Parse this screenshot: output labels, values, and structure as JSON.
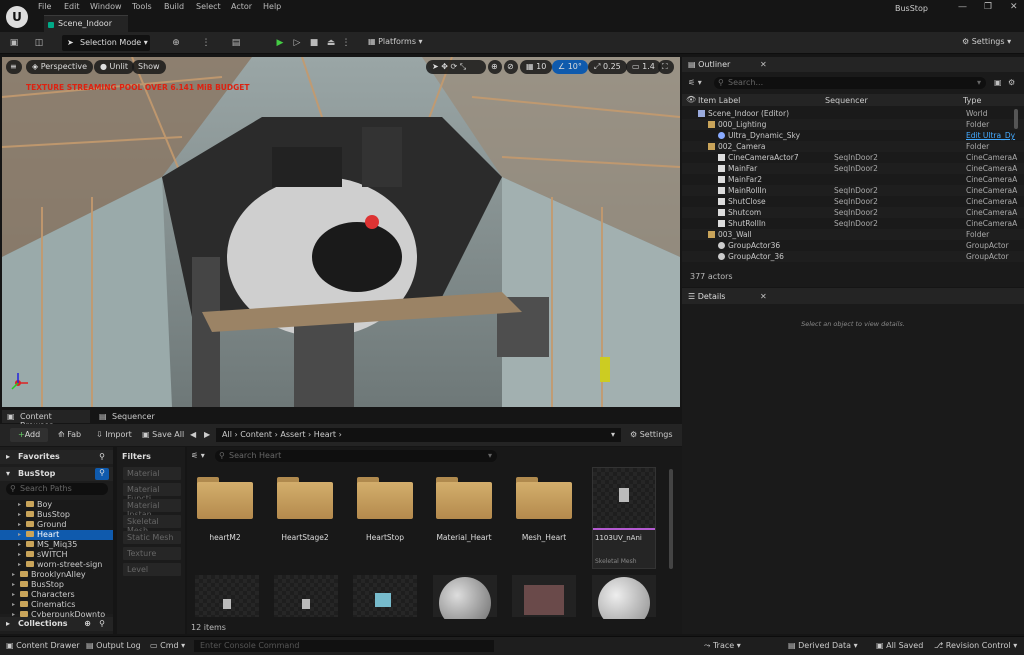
{
  "app": {
    "name": "BusStop",
    "menu": [
      "File",
      "Edit",
      "Window",
      "Tools",
      "Build",
      "Select",
      "Actor",
      "Help"
    ],
    "document_tab": "Scene_Indoor"
  },
  "toolbar": {
    "selection_mode": "Selection Mode",
    "platforms": "Platforms",
    "settings": "Settings"
  },
  "viewport": {
    "view_mode": "Perspective",
    "lighting": "Unlit",
    "show": "Show",
    "grid_size": "10",
    "rotation_snap": "10°",
    "scale_snap": "0.25",
    "camera_speed": "1.4",
    "warning": "TEXTURE STREAMING POOL OVER 6.141 MiB BUDGET"
  },
  "content_browser": {
    "tabs": [
      "Content Browser",
      "Sequencer"
    ],
    "add": "Add",
    "fab": "Fab",
    "import": "Import",
    "save_all": "Save All",
    "settings": "Settings",
    "breadcrumb": [
      "All",
      "Content",
      "Assert",
      "Heart"
    ],
    "favorites": "Favorites",
    "project": "BusStop",
    "search_paths_placeholder": "Search Paths",
    "search_assets_placeholder": "Search Heart",
    "filters_title": "Filters",
    "filters": [
      "Material",
      "Material Functi",
      "Material Instan",
      "Skeletal Mesh",
      "Static Mesh",
      "Texture",
      "Level"
    ],
    "tree": [
      {
        "label": "Boy",
        "indent": 1
      },
      {
        "label": "BusStop",
        "indent": 1
      },
      {
        "label": "Ground",
        "indent": 1
      },
      {
        "label": "Heart",
        "indent": 1,
        "selected": true
      },
      {
        "label": "MS_Miq35",
        "indent": 1
      },
      {
        "label": "sWITCH",
        "indent": 1
      },
      {
        "label": "worn-street-sign",
        "indent": 1
      },
      {
        "label": "BrooklynAlley",
        "indent": 0
      },
      {
        "label": "BusStop",
        "indent": 0
      },
      {
        "label": "Characters",
        "indent": 0
      },
      {
        "label": "Cinematics",
        "indent": 0
      },
      {
        "label": "CyberpunkDownto",
        "indent": 0
      },
      {
        "label": "CyberPunkMegapa",
        "indent": 0
      }
    ],
    "collections": "Collections",
    "folders": [
      "heartM2",
      "HeartStage2",
      "HeartStop",
      "Material_Heart",
      "Mesh_Heart"
    ],
    "featured_asset": {
      "name": "1103UV_nAni",
      "type": "Skeletal Mesh"
    },
    "item_count": "12 items"
  },
  "outliner": {
    "title": "Outliner",
    "search_placeholder": "Search...",
    "columns": [
      "Item Label",
      "Sequencer",
      "Type"
    ],
    "rows": [
      {
        "label": "Scene_Indoor (Editor)",
        "seq": "",
        "type": "World",
        "indent": 0,
        "kind": "world"
      },
      {
        "label": "000_Lighting",
        "seq": "",
        "type": "Folder",
        "indent": 1,
        "kind": "folder"
      },
      {
        "label": "Ultra_Dynamic_Sky",
        "seq": "",
        "type": "Edit Ultra_Dy",
        "indent": 2,
        "kind": "actor",
        "link": true
      },
      {
        "label": "002_Camera",
        "seq": "",
        "type": "Folder",
        "indent": 1,
        "kind": "folder"
      },
      {
        "label": "CineCameraActor7",
        "seq": "SeqInDoor2",
        "type": "CineCameraA",
        "indent": 2,
        "kind": "cam"
      },
      {
        "label": "MainFar",
        "seq": "SeqInDoor2",
        "type": "CineCameraA",
        "indent": 2,
        "kind": "cam"
      },
      {
        "label": "MainFar2",
        "seq": "",
        "type": "CineCameraA",
        "indent": 2,
        "kind": "cam"
      },
      {
        "label": "MainRollIn",
        "seq": "SeqInDoor2",
        "type": "CineCameraA",
        "indent": 2,
        "kind": "cam"
      },
      {
        "label": "ShutClose",
        "seq": "SeqInDoor2",
        "type": "CineCameraA",
        "indent": 2,
        "kind": "cam"
      },
      {
        "label": "Shutcom",
        "seq": "SeqInDoor2",
        "type": "CineCameraA",
        "indent": 2,
        "kind": "cam"
      },
      {
        "label": "ShutRollIn",
        "seq": "SeqInDoor2",
        "type": "CineCameraA",
        "indent": 2,
        "kind": "cam"
      },
      {
        "label": "003_Wall",
        "seq": "",
        "type": "Folder",
        "indent": 1,
        "kind": "folder"
      },
      {
        "label": "GroupActor36",
        "seq": "",
        "type": "GroupActor",
        "indent": 2,
        "kind": "group"
      },
      {
        "label": "GroupActor_36",
        "seq": "",
        "type": "GroupActor",
        "indent": 2,
        "kind": "group"
      }
    ],
    "actor_count": "377 actors"
  },
  "details": {
    "title": "Details",
    "empty_message": "Select an object to view details."
  },
  "status_bar": {
    "content_drawer": "Content Drawer",
    "output_log": "Output Log",
    "cmd": "Cmd",
    "console_placeholder": "Enter Console Command",
    "trace": "Trace",
    "derived_data": "Derived Data",
    "all_saved": "All Saved",
    "revision_control": "Revision Control"
  }
}
